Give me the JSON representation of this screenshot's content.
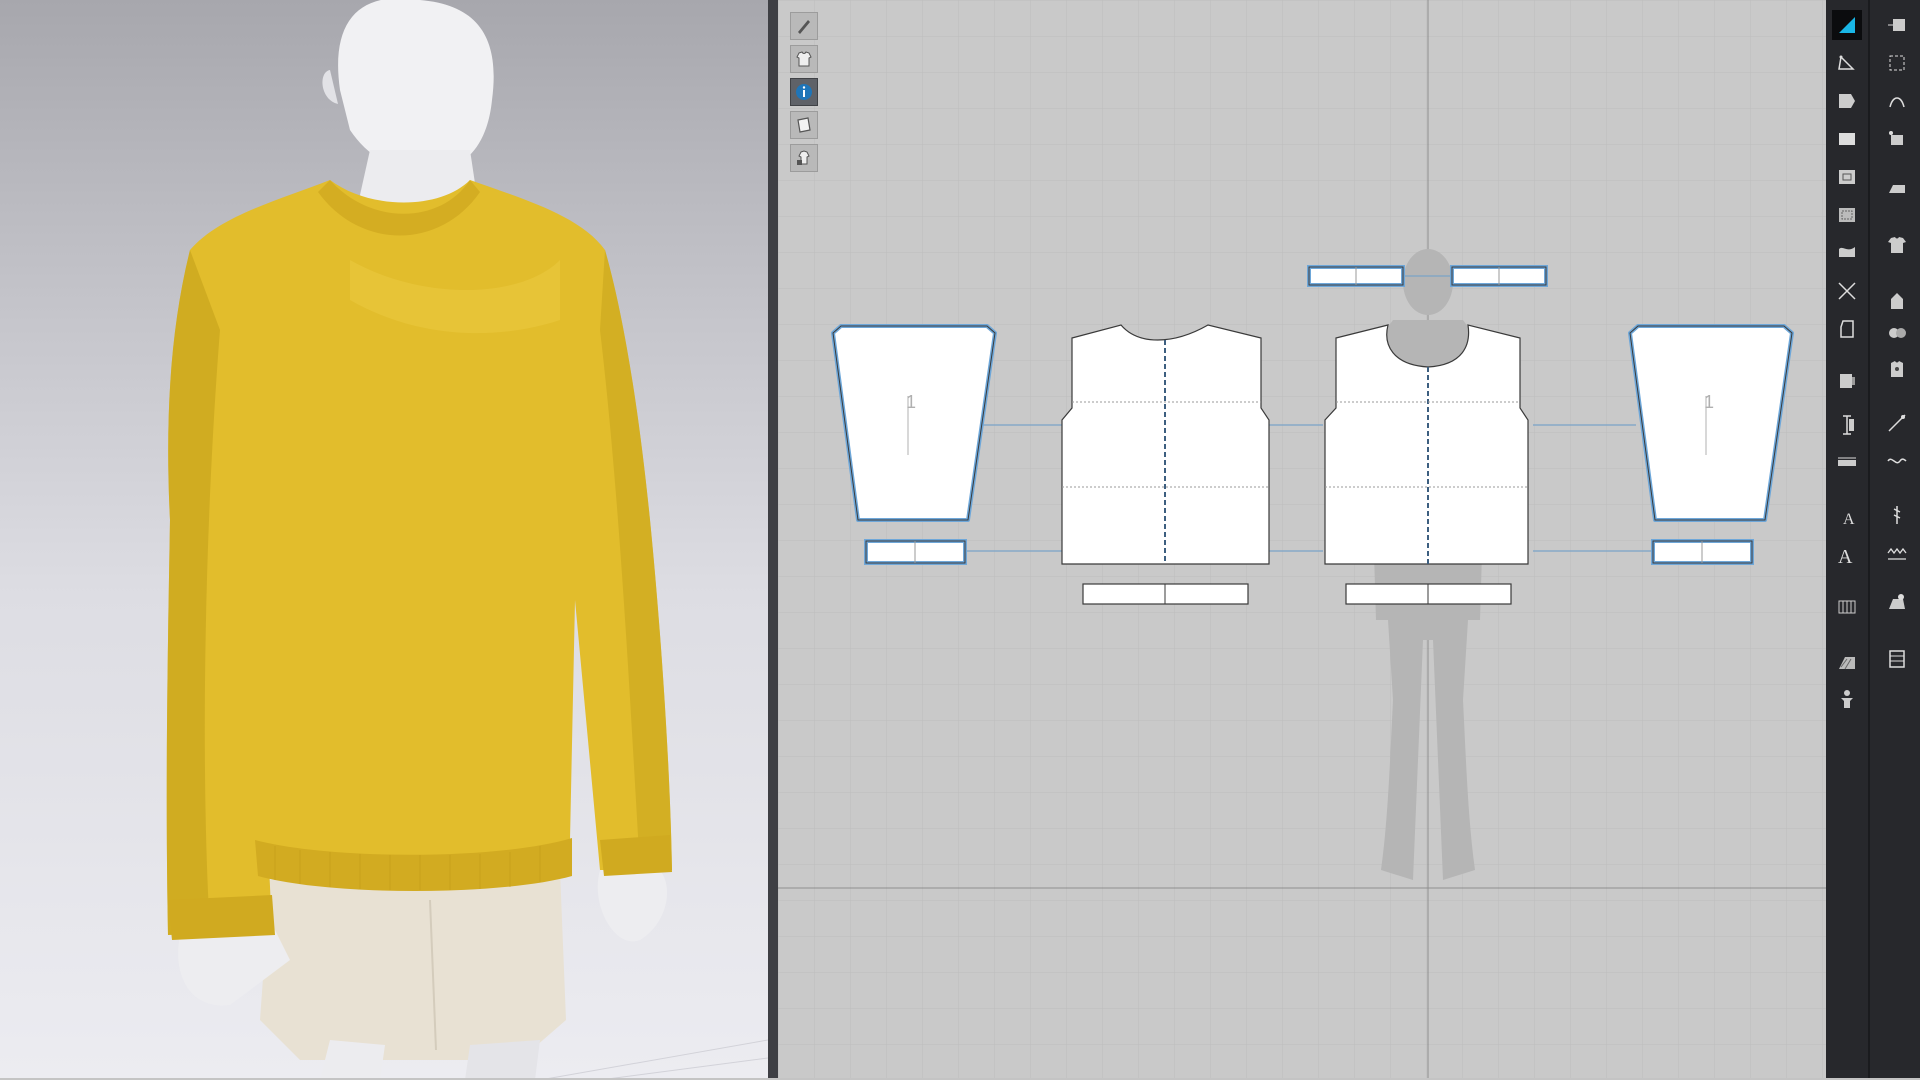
{
  "app": {
    "accent_color": "#19b6e6",
    "garment_color": "#e2bd2c",
    "pattern_outline_color": "#6ea7d9",
    "canvas_color": "#c9c9c9"
  },
  "viewport3d": {
    "garment": "sweatshirt",
    "avatar": "male-mannequin"
  },
  "pattern2d": {
    "toolbar": [
      {
        "icon": "pen-icon"
      },
      {
        "icon": "garment-icon"
      },
      {
        "icon": "info-icon",
        "active": true
      },
      {
        "icon": "sheet-icon"
      },
      {
        "icon": "lock-garment-icon"
      }
    ],
    "pieces": [
      {
        "name": "left-sleeve",
        "label": "1",
        "selected": true
      },
      {
        "name": "front-body"
      },
      {
        "name": "back-body"
      },
      {
        "name": "right-sleeve",
        "label": "1",
        "selected": true
      },
      {
        "name": "left-cuff",
        "selected": true
      },
      {
        "name": "right-cuff",
        "selected": true
      },
      {
        "name": "collar-left",
        "selected": true
      },
      {
        "name": "collar-right",
        "selected": true
      },
      {
        "name": "front-hem-band"
      },
      {
        "name": "back-hem-band"
      }
    ]
  },
  "toolbar_right": {
    "left_column": [
      "select-icon",
      "transform-pattern-icon",
      "edit-pattern-icon",
      "rectangle-icon",
      "internal-polygon-icon",
      "dart-icon",
      "fold-icon",
      "segment-icon",
      "notch-icon",
      "pleat-icon",
      "seam-length-icon",
      "ruler-icon",
      "text-icon",
      "annotation-icon",
      "grid-icon",
      "fabric-texture-icon",
      "avatar-tool-icon"
    ],
    "right_column": [
      "transform-arrange-icon",
      "add-point-icon",
      "curve-point-icon",
      "sew-icon",
      "iron-icon",
      "shirt-icon",
      "fold-arrange-icon",
      "puckering-icon",
      "button-icon",
      "pin-icon",
      "zipper-icon",
      "topstitch-icon",
      "stitch-icon",
      "elastic-icon",
      "texture-pick-icon",
      "trim-icon"
    ]
  }
}
